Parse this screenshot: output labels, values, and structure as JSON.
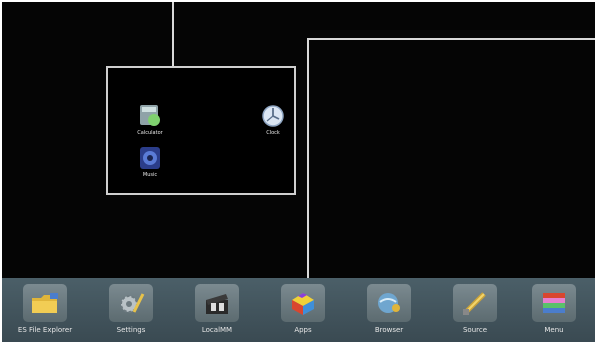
{
  "apps_panel": {
    "apps": [
      {
        "label": "Calculator",
        "icon": "calculator-icon"
      },
      {
        "label": "Clock",
        "icon": "clock-icon"
      },
      {
        "label": "Music",
        "icon": "music-icon"
      }
    ]
  },
  "dock": {
    "items": [
      {
        "label": "ES File Explorer",
        "icon": "folder-icon"
      },
      {
        "label": "Settings",
        "icon": "settings-icon"
      },
      {
        "label": "LocalMM",
        "icon": "film-clapper-icon"
      },
      {
        "label": "Apps",
        "icon": "apps-box-icon"
      },
      {
        "label": "Browser",
        "icon": "browser-icon"
      },
      {
        "label": "Source",
        "icon": "source-plug-icon"
      },
      {
        "label": "Menu",
        "icon": "menu-books-icon"
      }
    ]
  },
  "colors": {
    "screen_background": "#050505",
    "dock_background": "#42545c",
    "callout_line": "#d9d9d9"
  }
}
